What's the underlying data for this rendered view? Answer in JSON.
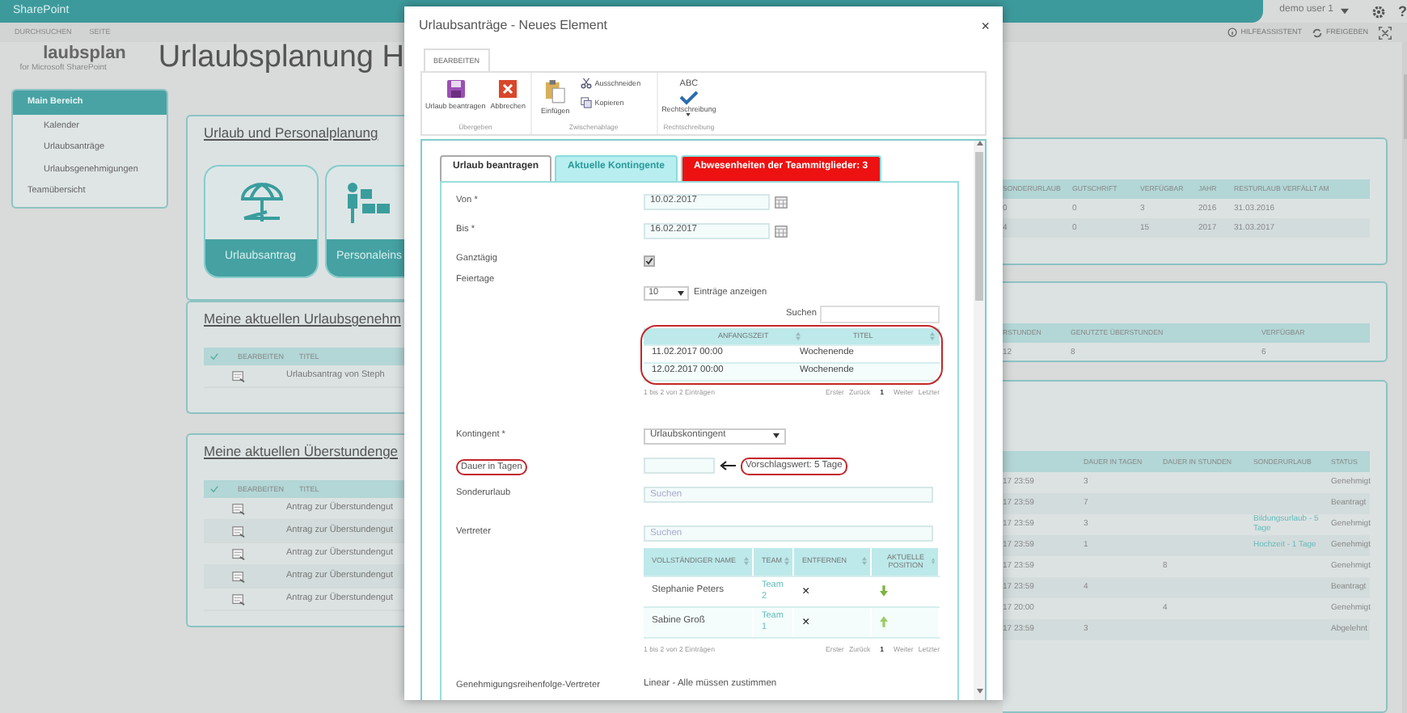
{
  "top_bar": {
    "brand": "SharePoint",
    "user": "demo user 1",
    "help": "?"
  },
  "suite_links": [
    "DURCHSUCHEN",
    "SEITE"
  ],
  "page_actions": [
    "HILFEASSISTENT",
    "FREIGEBEN"
  ],
  "logo": {
    "name": "laubsplan",
    "tagline": "for Microsoft SharePoint"
  },
  "page_title": "Urlaubsplanung H",
  "sidebar": {
    "items": [
      {
        "label": "Main Bereich",
        "children": [
          {
            "label": "Kalender"
          },
          {
            "label": "Urlaubsanträge"
          },
          {
            "label": "Urlaubsgenehmigungen"
          }
        ]
      },
      {
        "label": "Teamübersicht"
      }
    ]
  },
  "left_cards": [
    {
      "kind": "tiles",
      "title": "Urlaub und Personalplanung",
      "tiles": [
        "Urlaubsantrag",
        "Personaleins"
      ]
    },
    {
      "kind": "table",
      "title": "Meine aktuellen Urlaubsgenehm",
      "columns": [
        "BEARBEITEN",
        "TITEL"
      ],
      "rows": [
        "Urlaubsantrag von Steph"
      ]
    },
    {
      "kind": "table",
      "title": "Meine aktuellen Überstundenge",
      "columns": [
        "BEARBEITEN",
        "TITEL"
      ],
      "rows": [
        "Antrag zur Überstundengut",
        "Antrag zur Überstundengut",
        "Antrag zur Überstundengut",
        "Antrag zur Überstundengut",
        "Antrag zur Überstundengut"
      ]
    }
  ],
  "right_cards": [
    {
      "columns": [
        "SONDERURLAUB",
        "GUTSCHRIFT",
        "VERFÜGBAR",
        "JAHR",
        "RESTURLAUB VERFÄLLT AM"
      ],
      "rows": [
        [
          "0",
          "0",
          "3",
          "2016",
          "31.03.2016"
        ],
        [
          "4",
          "0",
          "15",
          "2017",
          "31.03.2017"
        ]
      ]
    },
    {
      "columns": [
        "RSTUNDEN",
        "GENUTZTE ÜBERSTUNDEN",
        "VERFÜGBAR"
      ],
      "rows": [
        [
          "12",
          "8",
          "6"
        ]
      ]
    },
    {
      "columns": [
        "",
        "DAUER IN TAGEN",
        "DAUER IN STUNDEN",
        "SONDERURLAUB",
        "STATUS"
      ],
      "rows": [
        [
          "17 23:59",
          "3",
          "",
          "",
          "Genehmigt"
        ],
        [
          "17 23:59",
          "7",
          "",
          "",
          "Beantragt"
        ],
        [
          "17 23:59",
          "3",
          "",
          "Bildungsurlaub - 5 Tage",
          "Genehmigt"
        ],
        [
          "17 23:59",
          "1",
          "",
          "Hochzeit - 1 Tage",
          "Genehmigt"
        ],
        [
          "17 23:59",
          "",
          "8",
          "",
          "Genehmigt"
        ],
        [
          "17 23:59",
          "4",
          "",
          "",
          "Beantragt"
        ],
        [
          "17 20:00",
          "",
          "4",
          "",
          "Genehmigt"
        ],
        [
          "17 23:59",
          "3",
          "",
          "",
          "Abgelehnt"
        ]
      ]
    }
  ],
  "modal": {
    "title": "Urlaubsanträge - Neues Element",
    "close": "×",
    "ribbon_tab": {
      "label": "BEARBEITEN",
      "selected": true
    },
    "ribbon_groups": [
      {
        "label": "Übergeben",
        "buttons": [
          {
            "kind": "save",
            "label": "Urlaub beantragen"
          },
          {
            "kind": "cancel",
            "label": "Abbrechen"
          }
        ]
      },
      {
        "label": "Zwischenablage",
        "buttons": [
          {
            "kind": "paste",
            "label": "Einfügen"
          },
          {
            "kind": "cut",
            "label": "Ausschneiden"
          },
          {
            "kind": "copy",
            "label": "Kopieren"
          }
        ]
      },
      {
        "label": "Rechtschreibung",
        "buttons": [
          {
            "kind": "spelling",
            "label": "Rechtschreibung",
            "icon_text": "ABC"
          }
        ]
      }
    ],
    "tabs": [
      {
        "label": "Urlaub beantragen",
        "selected": true,
        "color": "#ffffff"
      },
      {
        "label": "Aktuelle Kontingente",
        "selected": false,
        "color": "#b8eef0"
      },
      {
        "label": "Abwesenheiten der Teammitglieder: 3",
        "selected": false,
        "color": "#ee1111"
      }
    ],
    "fields": [
      {
        "kind": "date",
        "label": "Von *",
        "value": "10.02.2017"
      },
      {
        "kind": "date",
        "label": "Bis *",
        "value": "16.02.2017"
      },
      {
        "kind": "checkbox",
        "label": "Ganztägig",
        "checked": true
      },
      {
        "kind": "holidays",
        "label": "Feiertage",
        "page_size": "10",
        "page_size_label": "Einträge anzeigen",
        "search_label": "Suchen",
        "highlighted": true,
        "columns": [
          "ANFANGSZEIT",
          "TITEL"
        ],
        "rows": [
          [
            "11.02.2017 00:00",
            "Wochenende"
          ],
          [
            "12.02.2017 00:00",
            "Wochenende"
          ]
        ],
        "info": "1 bis 2 von 2 Einträgen",
        "pager": [
          {
            "label": "Erster",
            "selected": false
          },
          {
            "label": "Zurück",
            "selected": false
          },
          {
            "label": "1",
            "selected": true
          },
          {
            "label": "Weiter",
            "selected": false
          },
          {
            "label": "Letzter",
            "selected": false
          }
        ]
      },
      {
        "kind": "select",
        "label": "Kontingent *",
        "value": "Urlaubskontingent"
      },
      {
        "kind": "number",
        "label": "Dauer in Tagen",
        "label_highlighted": true,
        "hint": "Vorschlagswert: 5 Tage",
        "hint_highlighted": true
      },
      {
        "kind": "lookup",
        "label": "Sonderurlaub",
        "placeholder": "Suchen"
      },
      {
        "kind": "people",
        "label": "Vertreter",
        "placeholder": "Suchen",
        "columns": [
          "VOLLSTÄNDIGER NAME",
          "TEAM",
          "ENTFERNEN",
          "AKTUELLE POSITION"
        ],
        "rows": [
          {
            "name": "Stephanie Peters",
            "team": "Team 2",
            "remove": "×",
            "kind": "down"
          },
          {
            "name": "Sabine Groß",
            "team": "Team 1",
            "remove": "×",
            "kind": "up"
          }
        ],
        "info": "1 bis 2 von 2 Einträgen",
        "pager": [
          {
            "label": "Erster",
            "selected": false
          },
          {
            "label": "Zurück",
            "selected": false
          },
          {
            "label": "1",
            "selected": true
          },
          {
            "label": "Weiter",
            "selected": false
          },
          {
            "label": "Letzter",
            "selected": false
          }
        ]
      },
      {
        "kind": "text",
        "label": "Genehmigungsreihenfolge-Vertreter",
        "value": "Linear - Alle müssen zustimmen"
      }
    ]
  }
}
